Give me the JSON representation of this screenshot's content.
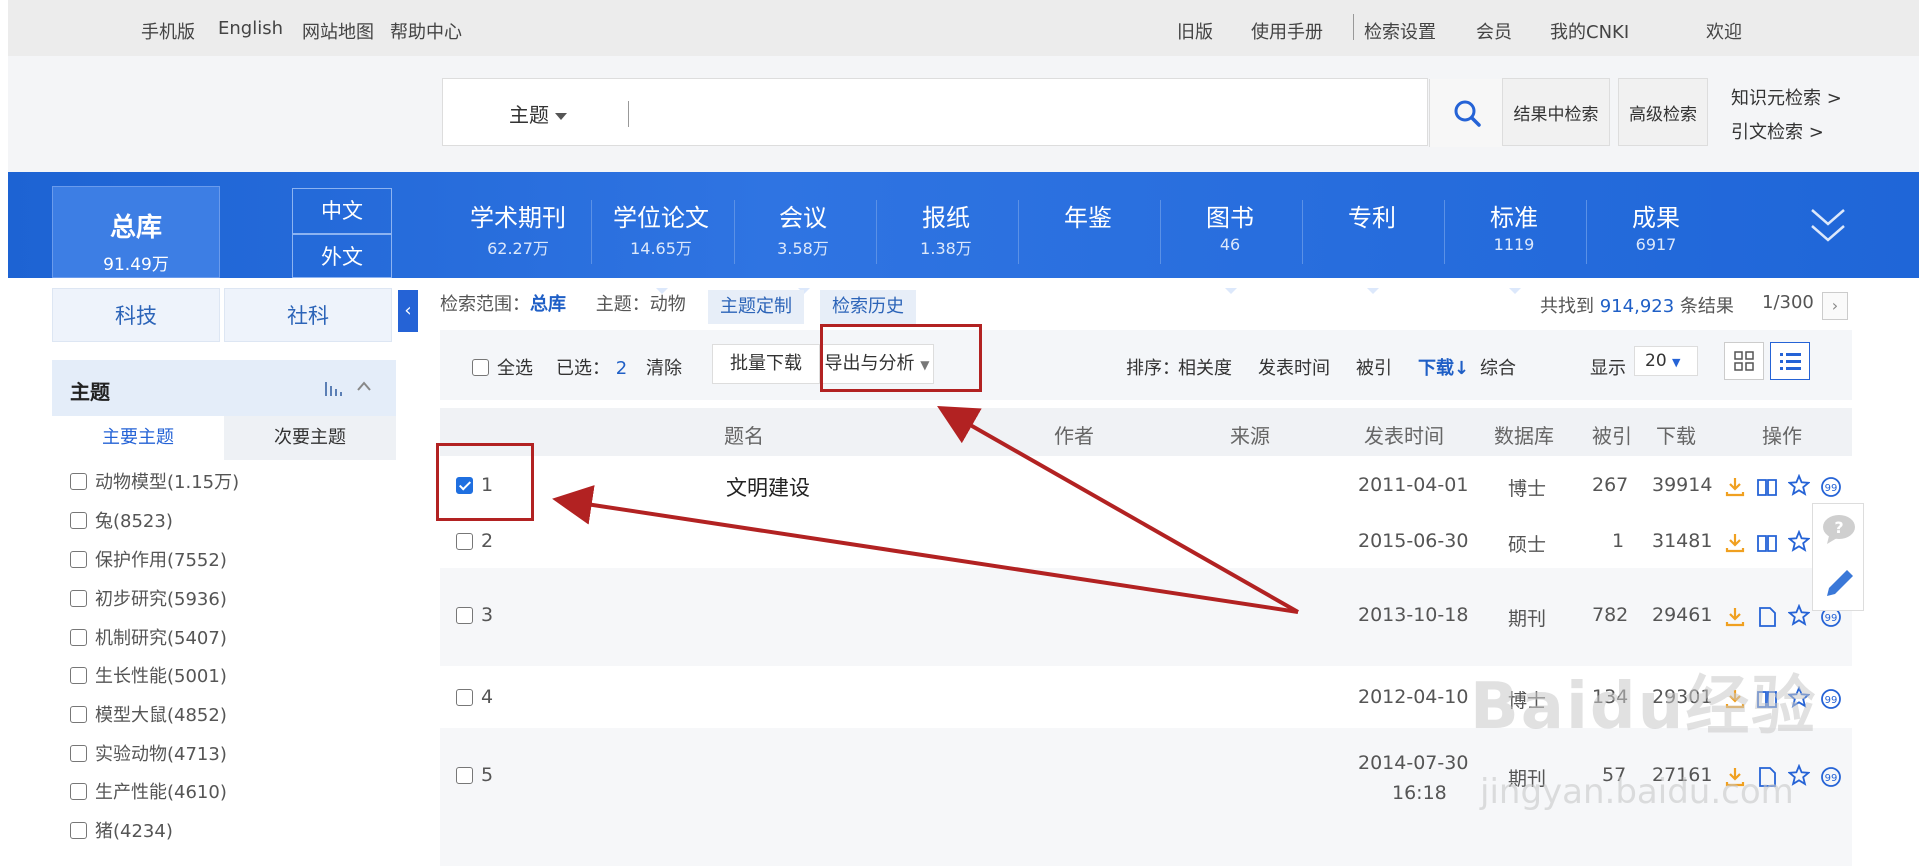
{
  "topnav": {
    "left": [
      "手机版",
      "English",
      "网站地图",
      "帮助中心"
    ],
    "right": [
      "旧版",
      "使用手册",
      "检索设置",
      "会员",
      "我的CNKI",
      "欢迎"
    ]
  },
  "search": {
    "field": "主题",
    "value": "",
    "in_results": "结果中检索",
    "advanced": "高级检索",
    "links": [
      "知识元检索  >",
      "引文检索  >"
    ]
  },
  "dbtabs": {
    "total_label": "总库",
    "total_count": "91.49万",
    "lang": [
      "中文",
      "外文"
    ],
    "items": [
      {
        "name": "学术期刊",
        "count": "62.27万"
      },
      {
        "name": "学位论文",
        "count": "14.65万"
      },
      {
        "name": "会议",
        "count": "3.58万"
      },
      {
        "name": "报纸",
        "count": "1.38万"
      },
      {
        "name": "年鉴",
        "count": ""
      },
      {
        "name": "图书",
        "count": "46"
      },
      {
        "name": "专利",
        "count": ""
      },
      {
        "name": "标准",
        "count": "1119"
      },
      {
        "name": "成果",
        "count": "6917"
      }
    ]
  },
  "left": {
    "subject_tabs": [
      "科技",
      "社科"
    ],
    "facet_title": "主题",
    "facet_tabs": [
      "主要主题",
      "次要主题"
    ],
    "facets": [
      "动物模型(1.15万)",
      "兔(8523)",
      "保护作用(7552)",
      "初步研究(5936)",
      "机制研究(5407)",
      "生长性能(5001)",
      "模型大鼠(4852)",
      "实验动物(4713)",
      "生产性能(4610)",
      "猪(4234)"
    ]
  },
  "main": {
    "scope_label": "检索范围：",
    "scope_value": "总库",
    "subject_label": "主题：动物",
    "pill1": "主题定制",
    "pill2": "检索历史",
    "found_prefix": "共找到",
    "found_count": "914,923",
    "found_suffix": "条结果",
    "page": "1/300",
    "select_all": "全选",
    "selected_label": "已选：",
    "selected_count": "2",
    "clear": "清除",
    "batch_download": "批量下载",
    "export": "导出与分析",
    "sort_label": "排序：",
    "sort_options": [
      "相关度",
      "发表时间",
      "被引",
      "下载",
      "综合"
    ],
    "display_label": "显示",
    "display_value": "20",
    "headers": [
      "题名",
      "作者",
      "来源",
      "发表时间",
      "数据库",
      "被引",
      "下载",
      "操作"
    ],
    "rows": [
      {
        "num": "1",
        "title": "文明建设",
        "date": "2011-04-01",
        "db": "博士",
        "cited": "267",
        "downloads": "39914",
        "checked": true
      },
      {
        "num": "2",
        "title": "",
        "date": "2015-06-30",
        "db": "硕士",
        "cited": "1",
        "downloads": "31481",
        "checked": false
      },
      {
        "num": "3",
        "title": "",
        "date": "2013-10-18",
        "db": "期刊",
        "cited": "782",
        "downloads": "29461",
        "checked": false
      },
      {
        "num": "4",
        "title": "",
        "date": "2012-04-10",
        "db": "博士",
        "cited": "134",
        "downloads": "29301",
        "checked": false
      },
      {
        "num": "5",
        "title": "",
        "date": "2014-07-30",
        "date2": "16:18",
        "db": "期刊",
        "cited": "57",
        "downloads": "27161",
        "checked": false
      }
    ]
  },
  "watermark": {
    "text": "Baidu经验",
    "sub": "jingyan.baidu.com"
  },
  "colors": {
    "brand_blue": "#2563d6",
    "annotation_red": "#b22222",
    "download_orange": "#f0a020"
  }
}
